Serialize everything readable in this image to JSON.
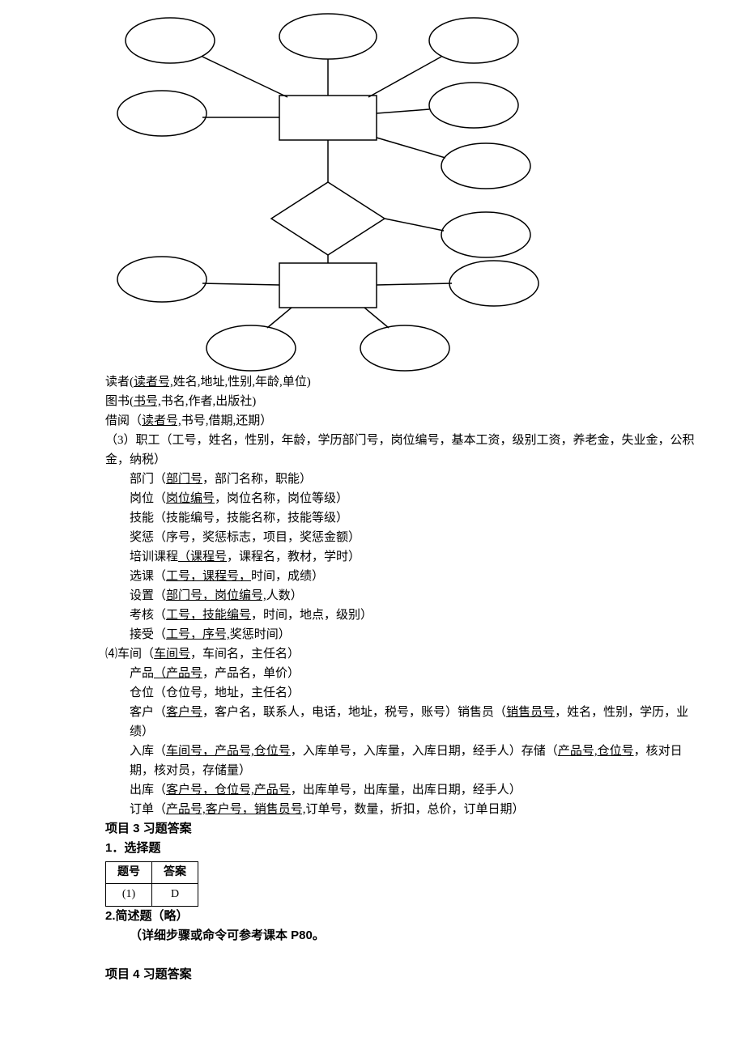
{
  "schemas": {
    "reader": {
      "name": "读者",
      "keys": "读者号,",
      "rest": "姓名,地址,性别,年龄,单位)"
    },
    "book": {
      "name": "图书",
      "keys": "书号,",
      "rest": "书名,作者,出版社)"
    },
    "borrow": {
      "name": "借阅",
      "keys": "读者号,",
      "rest": "书号,借期,还期）"
    },
    "employee_intro": "（3）职工（工号，姓名，性别，年龄，学历部门号，岗位编号，基本工资，级别工资，养老金，失业金，公积金，纳税）",
    "dept": {
      "name": "部门",
      "keys": "部门号",
      "rest": "，部门名称，职能）"
    },
    "position_row": {
      "name": "岗位",
      "keys": "岗位编号",
      "rest": "，岗位名称，岗位等级）"
    },
    "skill": "技能（技能编号，技能名称，技能等级）",
    "reward": "奖惩（序号，奖惩标志，项目，奖惩金额）",
    "course": {
      "name": "培训课程",
      "keys": "（课程号",
      "rest": "，课程名，教材，学时）"
    },
    "select_course": {
      "name": "选课",
      "keys": "工号，课程号，",
      "rest": "时间，成绩）"
    },
    "setup": {
      "name": "设置",
      "keys": "部门号，岗位编号,",
      "rest": "人数）"
    },
    "assess": {
      "name": "考核",
      "keys": "工号，技能编号",
      "rest": "，时间，地点，级别）"
    },
    "accept": {
      "name": "接受",
      "keys": "工号，序号,",
      "rest": "奖惩时间）"
    },
    "workshop": {
      "name": "⑷车间",
      "keys": "车间号",
      "rest": "，车间名，主任名）"
    },
    "product": {
      "name": "产品",
      "keys": "（产品号",
      "rest": "，产品名，单价）"
    },
    "warehouse": "仓位（仓位号，地址，主任名）",
    "customer": {
      "name": "客户",
      "keys": "客户号",
      "mid": "，客户名，联系人，电话，地址，税号，账号）销售员（",
      "keys2": "销售员号",
      "rest": "，姓名，性别，学历，业绩）"
    },
    "instock": {
      "name": "入库",
      "keys": "车间号，产品号,仓位号",
      "mid": "，入库单号，入库量，入库日期，经手人）存储（",
      "keys2": "产品号,仓位号",
      "rest": "，核对日期，核对员，存储量）"
    },
    "outstock": {
      "name": "出库",
      "keys": "客户号，仓位号,产品号",
      "rest": "，出库单号，出库量，出库日期，经手人）"
    },
    "order": {
      "name": "订单",
      "keys": "产品号,客户号，销售员号,",
      "rest": "订单号，数量，折扣，总价，订单日期）"
    }
  },
  "headings": {
    "p3": "项目 3 习题答案",
    "choice": "1．选择题",
    "brief": "2.简述题（略）",
    "detail": "（详细步骤或命令可参考课本 P80。",
    "p4": "项目 4 习题答案"
  },
  "table": {
    "h1": "题号",
    "h2": "答案",
    "r1c1": "(1)",
    "r1c2": "D"
  }
}
